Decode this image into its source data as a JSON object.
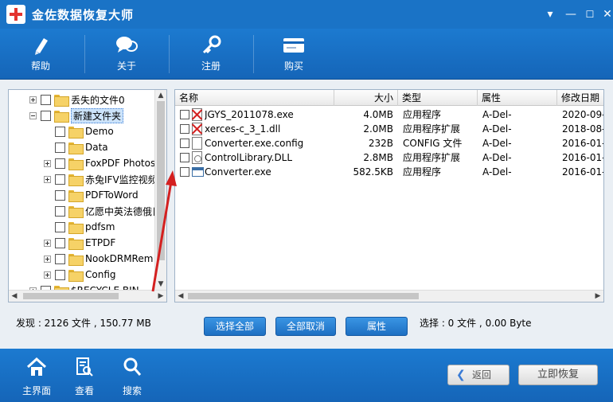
{
  "app": {
    "title": "金佐数据恢复大师"
  },
  "window_controls": {
    "menu": "▾",
    "minimize": "—",
    "maximize": "☐",
    "close": "✕"
  },
  "toolbar": {
    "items": [
      {
        "label": "帮助",
        "icon": "pen-icon"
      },
      {
        "label": "关于",
        "icon": "chat-bubble-icon"
      },
      {
        "label": "注册",
        "icon": "key-icon"
      },
      {
        "label": "购买",
        "icon": "card-icon"
      }
    ]
  },
  "tree": {
    "items": [
      {
        "label": "丢失的文件0",
        "expander": "plus",
        "level": 1
      },
      {
        "label": "新建文件夹",
        "expander": "minus",
        "level": 1,
        "selected": true
      },
      {
        "label": "Demo",
        "expander": "none",
        "level": 2
      },
      {
        "label": "Data",
        "expander": "none",
        "level": 2
      },
      {
        "label": "FoxPDF Photos",
        "expander": "plus",
        "level": 2
      },
      {
        "label": "赤兔IFV监控视频",
        "expander": "plus",
        "level": 2
      },
      {
        "label": "PDFToWord",
        "expander": "none",
        "level": 2
      },
      {
        "label": "亿愿中英法德俄日",
        "expander": "none",
        "level": 2
      },
      {
        "label": "pdfsm",
        "expander": "none",
        "level": 2
      },
      {
        "label": "ETPDF",
        "expander": "plus",
        "level": 2
      },
      {
        "label": "NookDRMRem",
        "expander": "plus",
        "level": 2
      },
      {
        "label": "Config",
        "expander": "plus",
        "level": 2
      },
      {
        "label": "$RECYCLE.BIN",
        "expander": "plus",
        "level": 1
      }
    ]
  },
  "list": {
    "columns": [
      "名称",
      "大小",
      "类型",
      "属性",
      "修改日期"
    ],
    "rows": [
      {
        "name": "JGYS_2011078.exe",
        "size": "4.0MB",
        "type": "应用程序",
        "attr": "A-Del-",
        "date": "2020-09-",
        "icon": "deleted"
      },
      {
        "name": "xerces-c_3_1.dll",
        "size": "2.0MB",
        "type": "应用程序扩展",
        "attr": "A-Del-",
        "date": "2018-08-",
        "icon": "deleted"
      },
      {
        "name": "Converter.exe.config",
        "size": "232B",
        "type": "CONFIG 文件",
        "attr": "A-Del-",
        "date": "2016-01-",
        "icon": "blank"
      },
      {
        "name": "ControlLibrary.DLL",
        "size": "2.8MB",
        "type": "应用程序扩展",
        "attr": "A-Del-",
        "date": "2016-01-",
        "icon": "gear"
      },
      {
        "name": "Converter.exe",
        "size": "582.5KB",
        "type": "应用程序",
        "attr": "A-Del-",
        "date": "2016-01-",
        "icon": "exe"
      }
    ]
  },
  "status": {
    "found": "发现 : 2126 文件 , 150.77 MB",
    "selected": "选择 : 0 文件 , 0.00 Byte"
  },
  "actions": {
    "select_all": "选择全部",
    "deselect_all": "全部取消",
    "properties": "属性"
  },
  "bottom_nav": {
    "items": [
      {
        "label": "主界面",
        "icon": "home-icon"
      },
      {
        "label": "查看",
        "icon": "document-search-icon"
      },
      {
        "label": "搜索",
        "icon": "magnifier-icon"
      }
    ],
    "back": "返回",
    "recover": "立即恢复"
  },
  "colors": {
    "primary": "#1a73c6",
    "accent_red": "#d42020"
  }
}
